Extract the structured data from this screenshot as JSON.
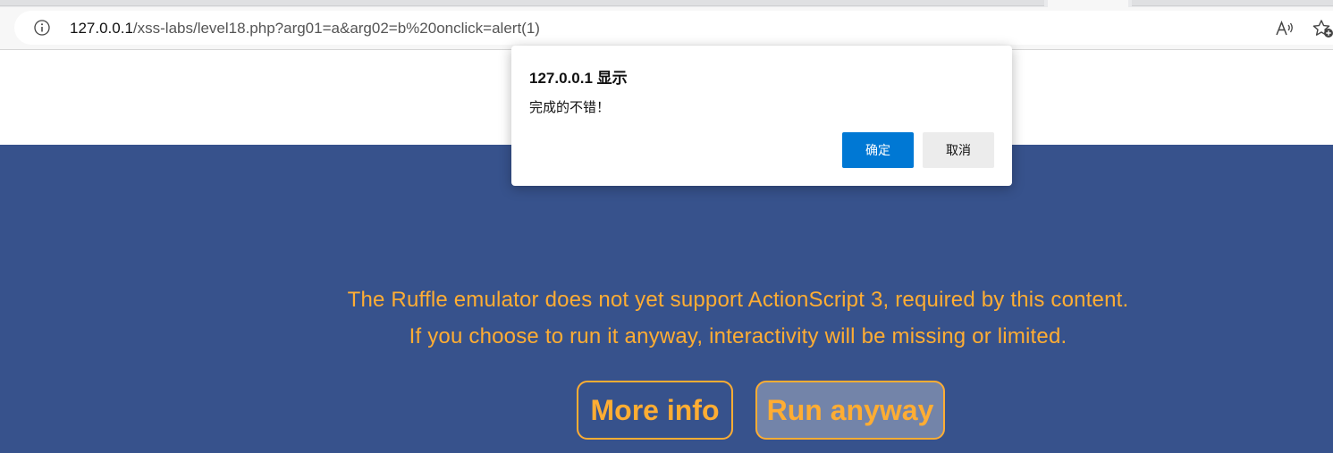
{
  "browser": {
    "url_host": "127.0.0.1",
    "url_path": "/xss-labs/level18.php?arg01=a&arg02=b%20onclick=alert(1)",
    "info_icon": "info-icon",
    "read_aloud_icon": "read-aloud-icon",
    "favorite_icon": "add-favorite-icon"
  },
  "ruffle": {
    "message_line1": "The Ruffle emulator does not yet support ActionScript 3, required by this content.",
    "message_line2": "If you choose to run it anyway, interactivity will be missing or limited.",
    "more_info_label": "More info",
    "run_anyway_label": "Run anyway",
    "background_color": "#37528c",
    "accent_color": "#ffad33"
  },
  "dialog": {
    "title": "127.0.0.1 显示",
    "message": "完成的不错！",
    "ok_label": "确定",
    "cancel_label": "取消",
    "ok_color": "#0078d4"
  }
}
